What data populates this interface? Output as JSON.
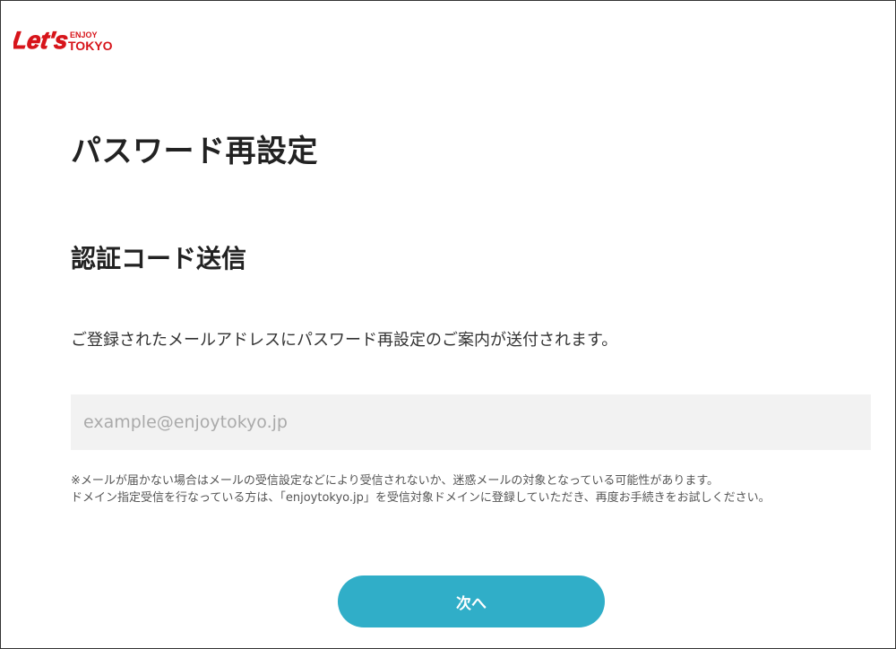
{
  "header": {
    "logo_main": "Let's",
    "logo_enjoy": "ENJOY",
    "logo_tokyo": "TOKYO",
    "logo_color": "#d7141a"
  },
  "main": {
    "page_title": "パスワード再設定",
    "section_title": "認証コード送信",
    "lead_text": "ご登録されたメールアドレスにパスワード再設定のご案内が送付されます。",
    "email_input": {
      "value": "",
      "placeholder": "example@enjoytokyo.jp"
    },
    "notes": [
      "※メールが届かない場合はメールの受信設定などにより受信されないか、迷惑メールの対象となっている可能性があります。",
      "ドメイン指定受信を行なっている方は、「enjoytokyo.jp」を受信対象ドメインに登録していただき、再度お手続きをお試しください。"
    ],
    "next_button_label": "次へ",
    "accent_color": "#30aec8"
  }
}
